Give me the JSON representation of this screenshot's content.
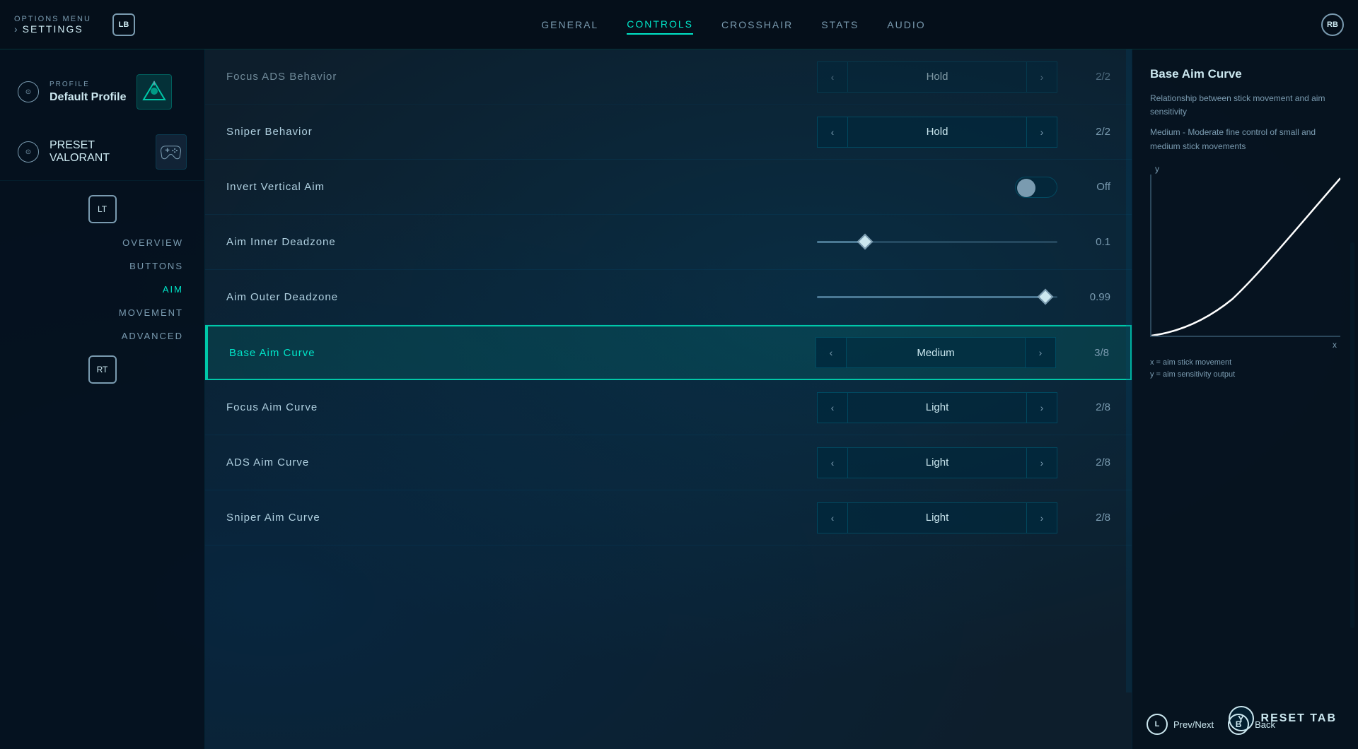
{
  "topNav": {
    "optionsMenu": "OPTIONS MENU",
    "settings": "SETTINGS",
    "lbButton": "LB",
    "rbButton": "RB",
    "tabs": [
      {
        "label": "GENERAL",
        "active": false
      },
      {
        "label": "CONTROLS",
        "active": true
      },
      {
        "label": "CROSSHAIR",
        "active": false
      },
      {
        "label": "STATS",
        "active": false
      },
      {
        "label": "AUDIO",
        "active": false
      }
    ]
  },
  "sidebar": {
    "profileLabel": "PROFILE",
    "profileName": "Default Profile",
    "presetLabel": "PRESET",
    "presetName": "VALORANT",
    "ltButton": "LT",
    "rtButton": "RT",
    "navItems": [
      {
        "label": "OVERVIEW",
        "active": false
      },
      {
        "label": "BUTTONS",
        "active": false
      },
      {
        "label": "AIM",
        "active": true
      },
      {
        "label": "MOVEMENT",
        "active": false
      },
      {
        "label": "ADVANCED",
        "active": false
      }
    ]
  },
  "settings": {
    "rows": [
      {
        "label": "Focus ADS Behavior",
        "controlType": "selector",
        "value": "Hold",
        "count": "2/2",
        "highlighted": false,
        "topPartial": true
      },
      {
        "label": "Sniper Behavior",
        "controlType": "selector",
        "value": "Hold",
        "count": "2/2",
        "highlighted": false,
        "topPartial": false
      },
      {
        "label": "Invert Vertical Aim",
        "controlType": "toggle",
        "value": "Off",
        "highlighted": false
      },
      {
        "label": "Aim Inner Deadzone",
        "controlType": "slider",
        "sliderPosition": 20,
        "value": "0.1",
        "highlighted": false
      },
      {
        "label": "Aim Outer Deadzone",
        "controlType": "slider",
        "sliderPosition": 95,
        "value": "0.99",
        "highlighted": false
      },
      {
        "label": "Base Aim Curve",
        "controlType": "selector",
        "value": "Medium",
        "count": "3/8",
        "highlighted": true
      },
      {
        "label": "Focus Aim Curve",
        "controlType": "selector",
        "value": "Light",
        "count": "2/8",
        "highlighted": false
      },
      {
        "label": "ADS Aim Curve",
        "controlType": "selector",
        "value": "Light",
        "count": "2/8",
        "highlighted": false
      },
      {
        "label": "Sniper Aim Curve",
        "controlType": "selector",
        "value": "Light",
        "count": "2/8",
        "highlighted": false
      }
    ]
  },
  "rightPanel": {
    "title": "Base Aim Curve",
    "description1": "Relationship between stick movement and aim sensitivity",
    "description2": "Medium - Moderate fine control of small and medium stick movements",
    "chartLabelY": "y",
    "chartLabelX": "x",
    "axisLabelX": "x = aim stick movement",
    "axisLabelY": "y = aim sensitivity output",
    "resetButton": "RESET TAB",
    "yButtonLabel": "Y",
    "prevNextLabel": "Prev/Next",
    "backLabel": "Back",
    "lButtonLabel": "L",
    "bButtonLabel": "B"
  }
}
